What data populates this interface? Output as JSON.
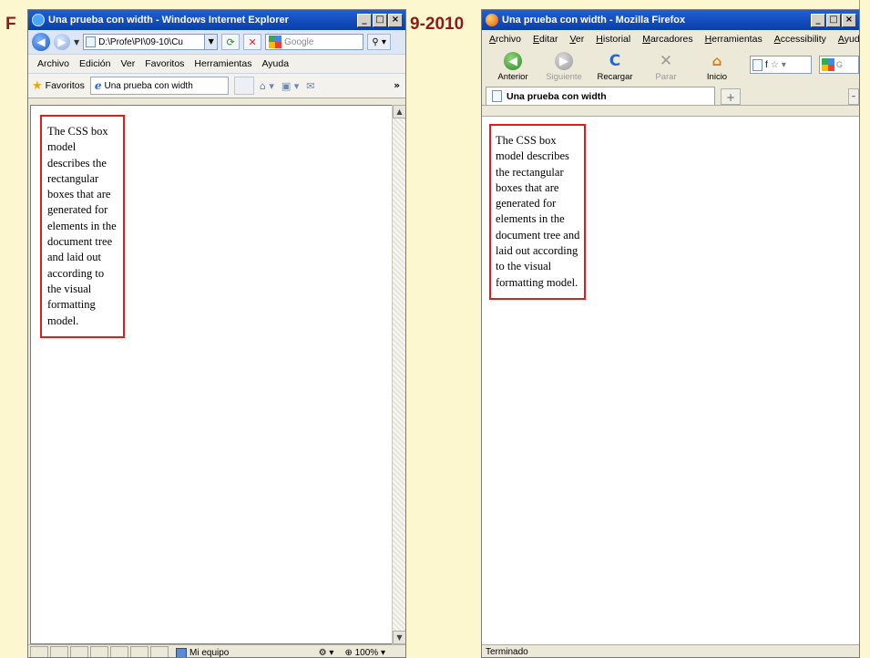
{
  "slide": {
    "title_left": "F",
    "title_right": "9-2010"
  },
  "ie": {
    "title": "Una prueba con width - Windows Internet Explorer",
    "window_buttons": [
      "_",
      "□",
      "×"
    ],
    "address": "D:\\Profe\\PI\\09-10\\Cu",
    "search_placeholder": "Google",
    "menu": [
      "Archivo",
      "Edición",
      "Ver",
      "Favoritos",
      "Herramientas",
      "Ayuda"
    ],
    "favorites_label": "Favoritos",
    "tab_label": "Una prueba con width",
    "more_label": "»",
    "box_text": "The CSS box model describes the rectangular boxes that are generated for elements in the document tree and laid out according to the visual formatting model.",
    "status_zone": "Mi equipo",
    "zoom": "100%"
  },
  "ff": {
    "title": "Una prueba con width - Mozilla Firefox",
    "window_buttons": [
      "_",
      "□",
      "×"
    ],
    "menu": [
      "Archivo",
      "Editar",
      "Ver",
      "Historial",
      "Marcadores",
      "Herramientas",
      "Accessibility",
      "Ayuda"
    ],
    "nav": {
      "back": "Anterior",
      "forward": "Siguiente",
      "reload": "Recargar",
      "stop": "Parar",
      "home": "Inicio"
    },
    "url_partial": "f",
    "search_partial": "G",
    "tab_label": "Una prueba con width",
    "newtab_symbol": "+",
    "box_text": "The CSS box model describes the rectangular boxes that are generated for elements in the document tree and laid out according to the visual formatting model.",
    "status": "Terminado"
  }
}
